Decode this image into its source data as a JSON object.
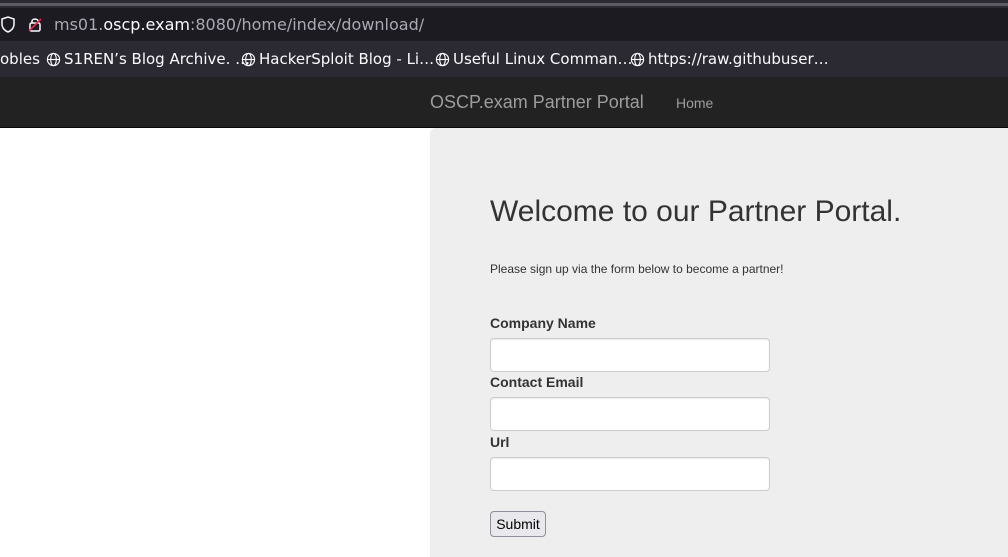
{
  "browser": {
    "url": {
      "prefix": "ms01.",
      "host": "oscp.exam",
      "suffix": ":8080/home/index/download/"
    },
    "bookmarks": [
      {
        "label": "obles",
        "icon": ""
      },
      {
        "label": "S1REN’s Blog Archive. …",
        "icon": "globe-icon"
      },
      {
        "label": "HackerSploit Blog - Li…",
        "icon": "globe-icon"
      },
      {
        "label": "Useful Linux Comman…",
        "icon": "globe-icon"
      },
      {
        "label": "https://raw.githubuser…",
        "icon": "globe-icon"
      }
    ]
  },
  "navbar": {
    "brand": "OSCP.exam Partner Portal",
    "home": "Home"
  },
  "main": {
    "title": "Welcome to our Partner Portal.",
    "lead": "Please sign up via the form below to become a partner!",
    "form": {
      "company_label": "Company Name",
      "company_value": "",
      "email_label": "Contact Email",
      "email_value": "",
      "url_label": "Url",
      "url_value": "",
      "submit": "Submit"
    }
  },
  "colors": {
    "chrome_dark": "#1c1b22",
    "chrome_toolbar": "#2b2a33",
    "navbar_bg": "#222222",
    "jumbotron_bg": "#eeeeee"
  }
}
